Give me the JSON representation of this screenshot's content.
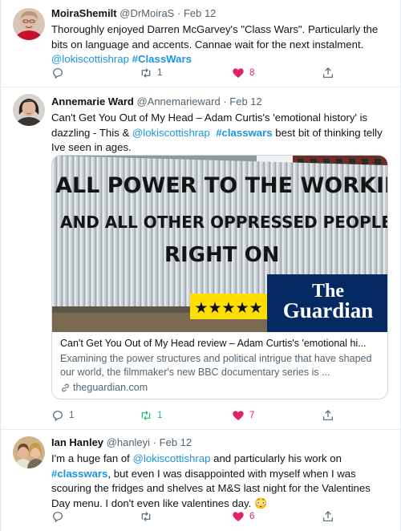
{
  "tweets": [
    {
      "name": "MoiraShemilt",
      "handle": "@DrMoiraS",
      "separator": "·",
      "date": "Feb 12",
      "text": "Thoroughly enjoyed Darren McGarvey's \"Class Wars\". Particularly the bits on language and accents. Cannae wait for the next instalment.",
      "mention": "@lokiscottishrap",
      "hashtag": "#ClassWars",
      "replies": "",
      "retweets": "1",
      "likes": "8"
    },
    {
      "name": "Annemarie Ward",
      "handle": "@Annemarieward",
      "separator": "·",
      "date": "Feb 12",
      "text_before": "Can't Get You Out of My Head  – Adam Curtis's 'emotional history' is dazzling - This & ",
      "mention": "@lokiscottishrap",
      "hashtag": "#classwars",
      "text_after": " best bit of thinking telly Ive seen in ages.",
      "card": {
        "graffiti_line1": "ALL POWER TO THE WORKING CLASS",
        "graffiti_line2": "AND ALL OTHER OPPRESSED PEOPLE",
        "graffiti_line3": "RIGHT ON",
        "stars": "★★★★★",
        "brand_line1": "The",
        "brand_line2": "Guardian",
        "title": "Can't Get You Out of My Head review – Adam Curtis's 'emotional hi...",
        "description": "Examining the power structures and political intrigue that have shaped our world, the filmmaker's new BBC documentary series is ...",
        "domain": "theguardian.com"
      },
      "replies": "1",
      "retweets": "1",
      "likes": "7"
    },
    {
      "name": "Ian Hanley",
      "handle": "@hanleyi",
      "separator": "·",
      "date": "Feb 12",
      "text_before": "I'm a huge fan of ",
      "mention": "@lokiscottishrap",
      "text_middle": " and particularly his work on ",
      "hashtag": "#classwars",
      "text_after": ", but even I was disappointed with myself when I was scouring the fridges and shelves at M&S last night for the Valentines Day menu. I don't even like valentines day. ",
      "emoji": "😳",
      "replies": "",
      "retweets": "",
      "likes": "6"
    }
  ],
  "colors": {
    "link": "#1b95e0",
    "like": "#e0245e",
    "retweet_active": "#17bf63",
    "muted": "#536471"
  }
}
